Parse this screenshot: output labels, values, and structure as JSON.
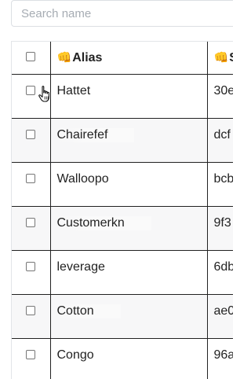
{
  "search": {
    "placeholder": "Search name",
    "value": ""
  },
  "table": {
    "columns": [
      {
        "icon": "👊",
        "label": "Alias"
      },
      {
        "icon": "👊",
        "label": "S"
      }
    ],
    "rows": [
      {
        "alias": "Hattet",
        "third": "30e"
      },
      {
        "alias": "Chairefef",
        "third": "dcf"
      },
      {
        "alias": "Walloopo",
        "third": "bcb"
      },
      {
        "alias": "Customerkn",
        "third": "9f3"
      },
      {
        "alias": "leverage",
        "third": "6db"
      },
      {
        "alias": "Cotton",
        "third": "ae0"
      },
      {
        "alias": "Congo",
        "third": "96a"
      }
    ]
  }
}
